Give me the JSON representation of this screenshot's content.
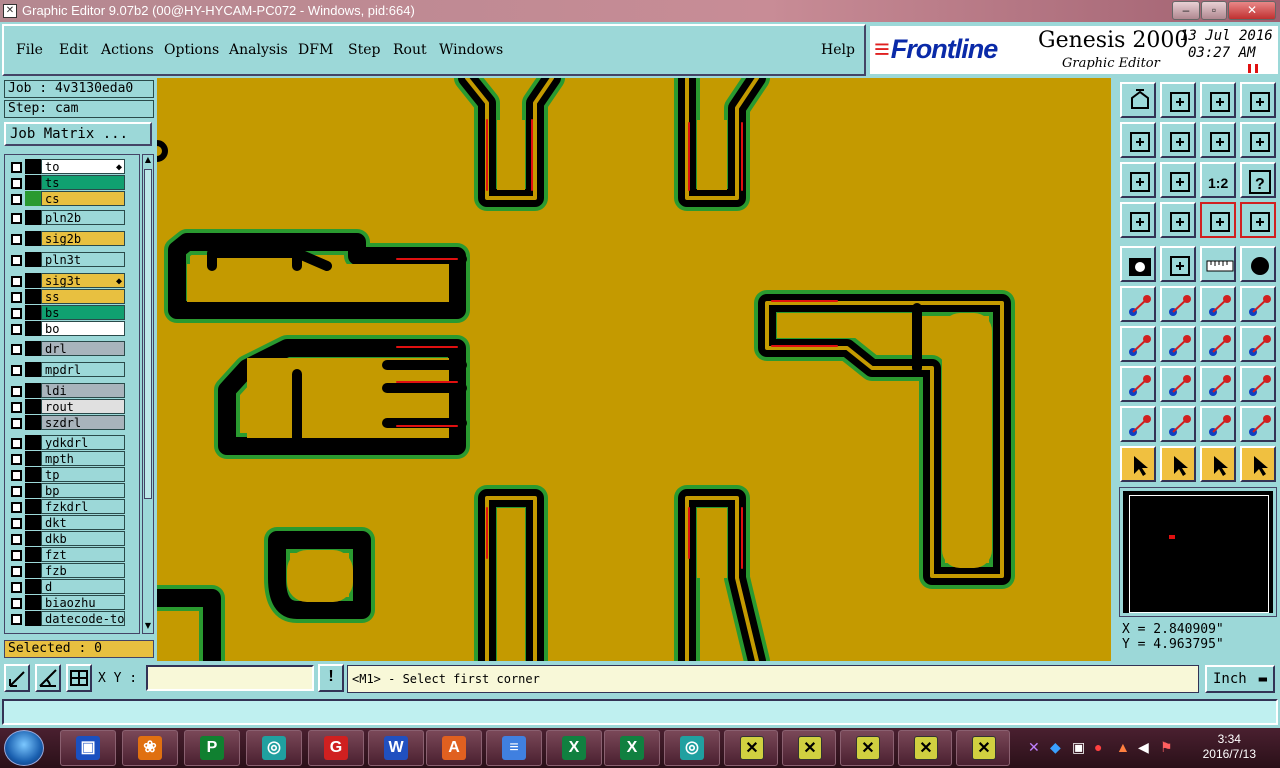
{
  "window": {
    "title": "Graphic Editor 9.07b2 (00@HY-HYCAM-PC072 - Windows, pid:664)",
    "buttons": {
      "minimize": "–",
      "maximize": "▫",
      "close": "✕"
    }
  },
  "menu": {
    "items": [
      {
        "label": "File"
      },
      {
        "label": "Edit"
      },
      {
        "label": "Actions"
      },
      {
        "label": "Options"
      },
      {
        "label": "Analysis"
      },
      {
        "label": "DFM"
      },
      {
        "label": "Step"
      },
      {
        "label": "Rout"
      },
      {
        "label": "Windows"
      }
    ],
    "help": "Help"
  },
  "brand": {
    "logo": "Frontline",
    "product": "Genesis 2000",
    "subtitle": "Graphic Editor",
    "date": "13 Jul 2016",
    "time": "03:27 AM"
  },
  "job": {
    "job_label": "Job : 4v3130eda0",
    "step_label": "Step: cam",
    "matrix_button": "Job Matrix ..."
  },
  "layers": [
    {
      "name": "to",
      "color": "#ffffff",
      "arrow": true
    },
    {
      "name": "ts",
      "color": "#10a070"
    },
    {
      "name": "cs",
      "color": "#e8c040",
      "mark": "#2a9a30"
    },
    {
      "name": "pln2b",
      "color": "#9cd8d8"
    },
    {
      "name": "sig2b",
      "color": "#e8c040"
    },
    {
      "name": "pln3t",
      "color": "#9cd8d8"
    },
    {
      "name": "sig3t",
      "color": "#e8c040",
      "arrow": true
    },
    {
      "name": "ss",
      "color": "#e8c040"
    },
    {
      "name": "bs",
      "color": "#10a070"
    },
    {
      "name": "bo",
      "color": "#ffffff"
    },
    {
      "name": "drl",
      "color": "#a8b4bc"
    },
    {
      "name": "mpdrl",
      "color": "#9cd8d8"
    },
    {
      "name": "ldi",
      "color": "#a8b4bc"
    },
    {
      "name": "rout",
      "color": "#e0e0e0"
    },
    {
      "name": "szdrl",
      "color": "#a8b4bc"
    },
    {
      "name": "ydkdrl",
      "color": "#9cd8d8"
    },
    {
      "name": "mpth",
      "color": "#9cd8d8"
    },
    {
      "name": "tp",
      "color": "#9cd8d8"
    },
    {
      "name": "bp",
      "color": "#9cd8d8"
    },
    {
      "name": "fzkdrl",
      "color": "#9cd8d8"
    },
    {
      "name": "dkt",
      "color": "#9cd8d8"
    },
    {
      "name": "dkb",
      "color": "#9cd8d8"
    },
    {
      "name": "fzt",
      "color": "#9cd8d8"
    },
    {
      "name": "fzb",
      "color": "#9cd8d8"
    },
    {
      "name": "d",
      "color": "#9cd8d8"
    },
    {
      "name": "biaozhu",
      "color": "#9cd8d8"
    },
    {
      "name": "datecode-to",
      "color": "#9cd8d8"
    }
  ],
  "selection": {
    "label": "Selected : 0"
  },
  "coords": {
    "x": "X = 2.840909\"",
    "y": "Y = 4.963795\""
  },
  "command": {
    "xy_label": "X Y :",
    "xy_value": "",
    "alert": "!",
    "prompt": "<M1> - Select first corner",
    "units": "Inch"
  },
  "taskbar": {
    "time": "3:34",
    "date": "2016/7/13"
  },
  "colors": {
    "board": "#c49a00",
    "copper_outline": "#000000",
    "clearance": "#2a9a30",
    "highlight": "#e01010",
    "panel": "#9cd8d8"
  },
  "toolbar_icons": [
    "zoom-home-icon",
    "zoom-in-window-icon",
    "home-icon",
    "page-icon",
    "pan-left-icon",
    "pan-right-icon",
    "undo-icon",
    "redo-icon",
    "fit-all-icon",
    "zoom-center-icon",
    "scale-1-2-icon",
    "help-icon",
    "snap-icon",
    "grid-icon",
    "layer-net-icon",
    "net-highlight-icon",
    "camera-icon",
    "select-box-icon",
    "ruler-icon",
    "dot-icon",
    "connect-nodes-icon",
    "cross-node-icon",
    "move-node-icon",
    "link-node-icon",
    "slice-icon",
    "line-icon",
    "arc-icon",
    "mirror-icon",
    "anchor-icon",
    "split-icon",
    "measure-icon",
    "cluster-icon",
    "poly-a-icon",
    "poly-b-icon",
    "poly-c-icon",
    "poly-d-icon",
    "pointer-icon",
    "pointer-select-icon",
    "pointer-region-icon",
    "pointer-route-icon"
  ]
}
